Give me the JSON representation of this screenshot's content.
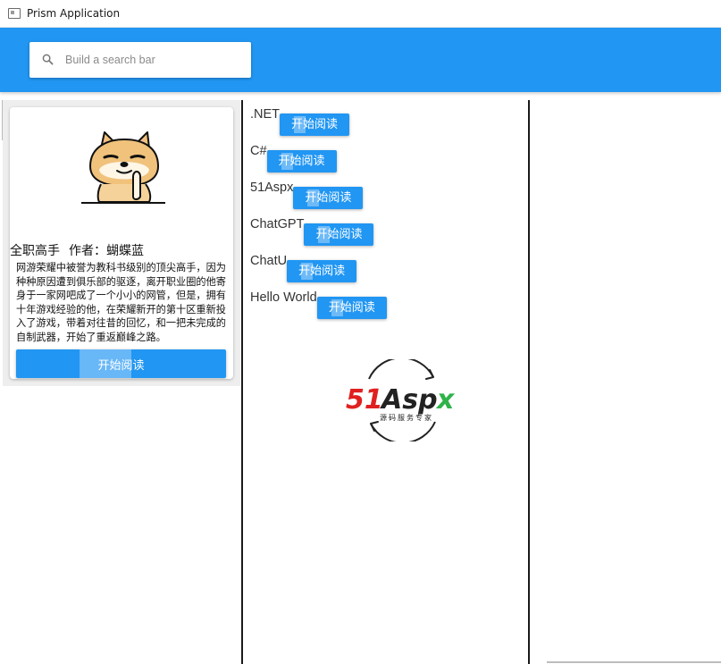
{
  "window": {
    "title": "Prism Application"
  },
  "search": {
    "placeholder": "Build a search bar",
    "value": ""
  },
  "featured": {
    "title": "全职高手",
    "author": "作者：蝴蝶蓝",
    "description": "网游荣耀中被誉为教科书级别的顶尖高手，因为种种原因遭到俱乐部的驱逐，离开职业圈的他寄身于一家网吧成了一个小小的网管，但是，拥有十年游戏经验的他，在荣耀新开的第十区重新投入了游戏，带着对往昔的回忆，和一把未完成的自制武器，开始了重返巅峰之路。",
    "button_label": "开始阅读"
  },
  "items": [
    {
      "name": ".NET",
      "button_label": "开始阅读"
    },
    {
      "name": "C#",
      "button_label": "开始阅读"
    },
    {
      "name": "51Aspx",
      "button_label": "开始阅读"
    },
    {
      "name": "ChatGPT",
      "button_label": "开始阅读"
    },
    {
      "name": "ChatU",
      "button_label": "开始阅读"
    },
    {
      "name": "Hello World",
      "button_label": "开始阅读"
    }
  ],
  "logo": {
    "brand": "51Aspx",
    "tagline": "源码服务专家"
  },
  "colors": {
    "primary": "#2196f3",
    "logo_red": "#e02020",
    "logo_green": "#2fb34a"
  },
  "icons": {
    "search": "search-icon",
    "app": "window-icon"
  }
}
